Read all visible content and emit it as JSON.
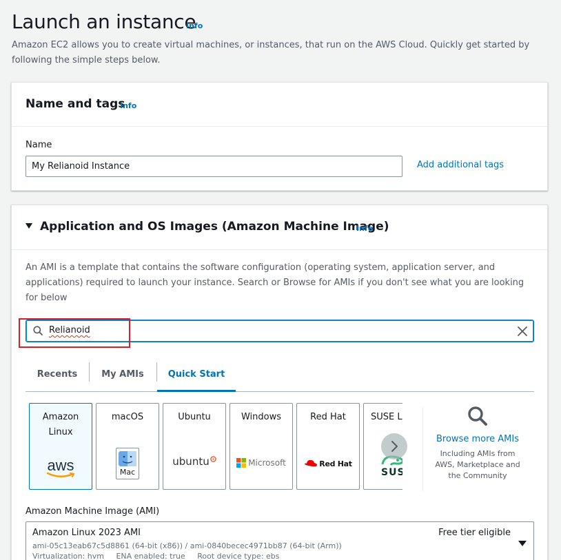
{
  "page": {
    "title": "Launch an instance",
    "info": "Info",
    "description": "Amazon EC2 allows you to create virtual machines, or instances, that run on the AWS Cloud. Quickly get started by following the simple steps below."
  },
  "name_tags": {
    "title": "Name and tags",
    "info": "Info",
    "name_label": "Name",
    "name_value": "My Relianoid Instance",
    "add_tags_link": "Add additional tags"
  },
  "ami": {
    "title": "Application and OS Images (Amazon Machine Image)",
    "info": "Info",
    "description": "An AMI is a template that contains the software configuration (operating system, application server, and applications) required to launch your instance. Search or Browse for AMIs if you don't see what you are looking for below",
    "search_value": "Relianoid",
    "tabs": [
      {
        "label": "Recents"
      },
      {
        "label": "My AMIs"
      },
      {
        "label": "Quick Start"
      }
    ],
    "os_cards": [
      {
        "name": "Amazon Linux",
        "logo_text": "aws"
      },
      {
        "name": "macOS",
        "logo_text": "Mac"
      },
      {
        "name": "Ubuntu",
        "logo_text": "ubuntu"
      },
      {
        "name": "Windows",
        "logo_text": "Microsoft"
      },
      {
        "name": "Red Hat",
        "logo_text": "Red Hat"
      },
      {
        "name": "SUSE Li",
        "logo_text": "SUS"
      }
    ],
    "browse_link": "Browse more AMIs",
    "browse_sub": "Including AMIs from AWS, Marketplace and the Community",
    "select_label": "Amazon Machine Image (AMI)",
    "selected": {
      "name": "Amazon Linux 2023 AMI",
      "ids": "ami-05c13eab67c5d8861 (64-bit (x86)) / ami-0840becec4971bb87 (64-bit (Arm))",
      "meta": "Virtualization: hvm     ENA enabled: true     Root device type: ebs",
      "badge": "Free tier eligible"
    }
  },
  "colors": {
    "link": "#0073bb",
    "highlight": "#e01b24",
    "aws_orange": "#ff9900",
    "ubuntu_orange": "#e95420",
    "redhat_red": "#ee0000",
    "suse_green": "#30ba78"
  }
}
